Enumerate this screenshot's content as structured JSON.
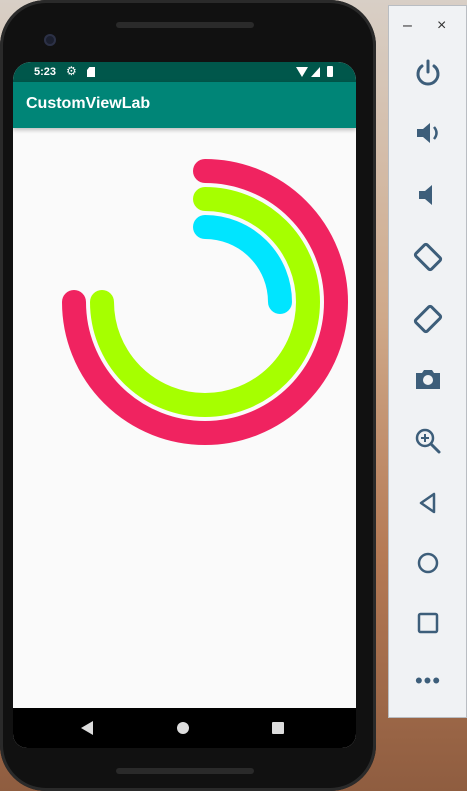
{
  "status_bar": {
    "time": "5:23"
  },
  "app_bar": {
    "title": "CustomViewLab",
    "color": "#008577"
  },
  "rings": [
    {
      "name": "outer",
      "color": "#f02360",
      "progress": 0.75
    },
    {
      "name": "middle",
      "color": "#a6ff00",
      "progress": 0.75
    },
    {
      "name": "inner",
      "color": "#00e5ff",
      "progress": 0.25
    }
  ],
  "emulator_panel": {
    "window_controls": {
      "minimize": "–",
      "close": "×"
    },
    "buttons": [
      "power-icon",
      "volume-up-icon",
      "volume-down-icon",
      "rotate-left-icon",
      "rotate-right-icon",
      "camera-icon",
      "zoom-icon",
      "back-icon",
      "home-icon",
      "overview-icon",
      "more-icon"
    ],
    "more_label": "•••",
    "icon_color": "#3d5e7a"
  },
  "nav_bar": {
    "buttons": [
      "back",
      "home",
      "recents"
    ]
  }
}
